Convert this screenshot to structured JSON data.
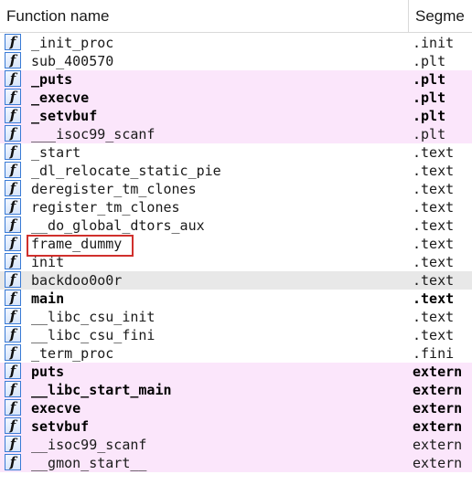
{
  "header": {
    "function_name_label": "Function name",
    "segment_label": "Segme"
  },
  "icon_glyph": "f",
  "colors": {
    "pink_row": "#fbe6fb",
    "selected_row": "#e8e8e8",
    "highlight_border": "#d0302c",
    "icon_border": "#3a7bd5"
  },
  "functions": [
    {
      "name": "_init_proc",
      "segment": ".init",
      "style": "normal"
    },
    {
      "name": "sub_400570",
      "segment": ".plt",
      "style": "normal"
    },
    {
      "name": "_puts",
      "segment": ".plt",
      "style": "pink-bold"
    },
    {
      "name": "_execve",
      "segment": ".plt",
      "style": "pink-bold"
    },
    {
      "name": "_setvbuf",
      "segment": ".plt",
      "style": "pink-bold"
    },
    {
      "name": "___isoc99_scanf",
      "segment": ".plt",
      "style": "pink"
    },
    {
      "name": "_start",
      "segment": ".text",
      "style": "normal"
    },
    {
      "name": "_dl_relocate_static_pie",
      "segment": ".text",
      "style": "normal"
    },
    {
      "name": "deregister_tm_clones",
      "segment": ".text",
      "style": "normal"
    },
    {
      "name": "register_tm_clones",
      "segment": ".text",
      "style": "normal"
    },
    {
      "name": "__do_global_dtors_aux",
      "segment": ".text",
      "style": "normal"
    },
    {
      "name": "frame_dummy",
      "segment": ".text",
      "style": "normal"
    },
    {
      "name": "init",
      "segment": ".text",
      "style": "normal"
    },
    {
      "name": "backdoo0o0r",
      "segment": ".text",
      "style": "selected"
    },
    {
      "name": "main",
      "segment": ".text",
      "style": "bold"
    },
    {
      "name": "__libc_csu_init",
      "segment": ".text",
      "style": "normal"
    },
    {
      "name": "__libc_csu_fini",
      "segment": ".text",
      "style": "normal"
    },
    {
      "name": "_term_proc",
      "segment": ".fini",
      "style": "normal"
    },
    {
      "name": "puts",
      "segment": "extern",
      "style": "pink-bold"
    },
    {
      "name": "__libc_start_main",
      "segment": "extern",
      "style": "pink-bold"
    },
    {
      "name": "execve",
      "segment": "extern",
      "style": "pink-bold"
    },
    {
      "name": "setvbuf",
      "segment": "extern",
      "style": "pink-bold"
    },
    {
      "name": "__isoc99_scanf",
      "segment": "extern",
      "style": "pink"
    },
    {
      "name": "__gmon_start__",
      "segment": "extern",
      "style": "pink"
    }
  ]
}
